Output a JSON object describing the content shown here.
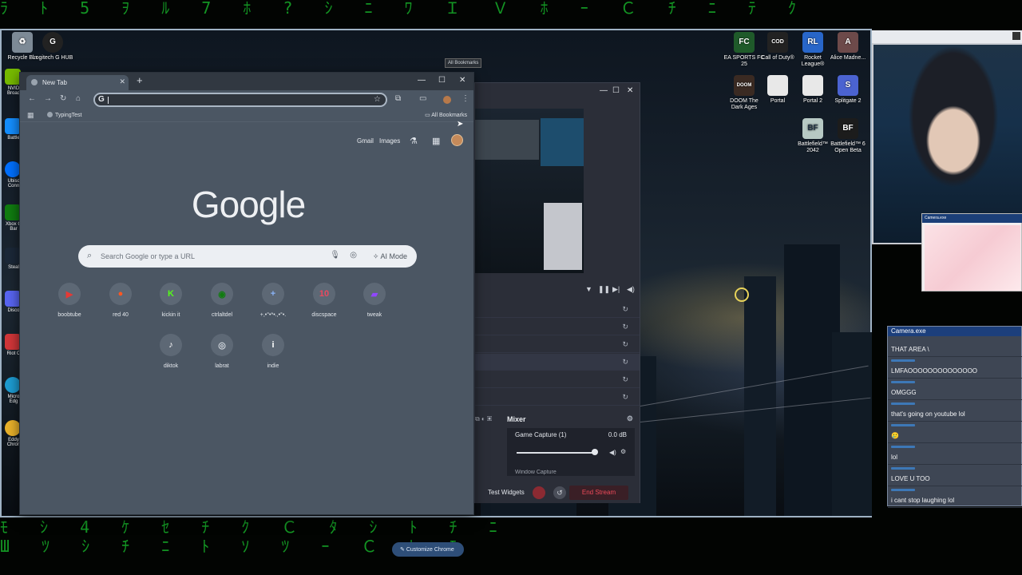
{
  "matrix": {
    "top": "ﾗ ﾄ 5 ｦ ﾙ 7 ﾎ ? ｼ ﾆ ﾜ Ｉ Ｖ ﾎ ｰ Ｃ ﾁ ﾆ ﾃ ｸ",
    "bottom1": "ﾓ ｼ 4 ｹ ｾ ﾁ ｸ Ｃ ﾀ ｼ ﾄ ﾁ ﾆ",
    "bottom2": "Ш ﾂ ｼ ﾁ ﾆ ﾄ ｿ ﾂ ｰ Ｃ ﾋ ﾓ"
  },
  "desktop": {
    "left_icons": [
      {
        "label": "Recycle Bin"
      },
      {
        "label": "Logitech G HUB"
      }
    ],
    "side_icons": [
      "NVID Broad",
      "Battle",
      "Ubisc Conn",
      "Xbox G Bar",
      "Steal",
      "Disco",
      "Riot C",
      "Micro Edg",
      "Eddy Chron"
    ],
    "right_icons": [
      {
        "label": "EA SPORTS FC 25",
        "badge": "FC",
        "color": "#1f5a2a"
      },
      {
        "label": "Call of Duty®",
        "badge": "COD",
        "color": "#222222"
      },
      {
        "label": "Rocket League®",
        "badge": "RL",
        "color": "#2866c9"
      },
      {
        "label": "Alice Madne...",
        "badge": "A",
        "color": "#6d4a4a"
      },
      {
        "label": "DOOM The Dark Ages",
        "badge": "DOOM",
        "color": "#3a2a22"
      },
      {
        "label": "Portal",
        "badge": "",
        "color": "#e8e8e8"
      },
      {
        "label": "Portal 2",
        "badge": "",
        "color": "#e8e8e8"
      },
      {
        "label": "Splitgate 2",
        "badge": "S",
        "color": "#4b63d1"
      },
      {
        "label": "Battlefield™ 2042",
        "badge": "BF",
        "color": "#b7c9c4"
      },
      {
        "label": "Battlefield™ 6 Open Beta",
        "badge": "BF",
        "color": "#1c1c1c"
      }
    ]
  },
  "chrome": {
    "tab_title": "New Tab",
    "omnibox_prefix": "G",
    "bookmark": "TypingTest",
    "all_bookmarks": "All Bookmarks",
    "tooltip": "All Bookmarks",
    "top_links": {
      "gmail": "Gmail",
      "images": "Images"
    },
    "logo": "Google",
    "search_placeholder": "Search Google or type a URL",
    "ai_mode": "AI Mode",
    "shortcuts": [
      {
        "label": "boobtube",
        "glyph": "▶",
        "color": "#e53935"
      },
      {
        "label": "red 40",
        "glyph": "●",
        "color": "#ff5722"
      },
      {
        "label": "kickin it",
        "glyph": "K",
        "color": "#53fc18"
      },
      {
        "label": "ctrlaltdel",
        "glyph": "◉",
        "color": "#107c10"
      },
      {
        "label": "+,•°•*•.,•°•.",
        "glyph": "+",
        "color": "#8ab4f8"
      },
      {
        "label": "discspace",
        "glyph": "10",
        "color": "#e84a5f"
      },
      {
        "label": "tweak",
        "glyph": "▰",
        "color": "#9146ff"
      },
      {
        "label": "diktok",
        "glyph": "♪",
        "color": "#ffffff"
      },
      {
        "label": "labrat",
        "glyph": "◎",
        "color": "#cfd5dc"
      },
      {
        "label": "indie",
        "glyph": "i",
        "color": "#ffffff"
      }
    ],
    "customize": "Customize Chrome"
  },
  "obs": {
    "mixer_title": "Mixer",
    "source": "Game Capture (1)",
    "level": "0.0 dB",
    "next_source": "Window Capture",
    "slider_level": 0.98,
    "test_widgets": "Test Widgets",
    "end_stream": "End Stream"
  },
  "camera": {
    "title": "Camera.exe"
  },
  "chat": {
    "title": "Camera.exe",
    "messages": [
      "THAT AREA \\",
      "LMFAOOOOOOOOOOOOOO",
      "OMGGG",
      "that's going on youtube lol",
      "🥲",
      "lol",
      "LOVE U TOO",
      "i cant stop laughing lol"
    ]
  }
}
